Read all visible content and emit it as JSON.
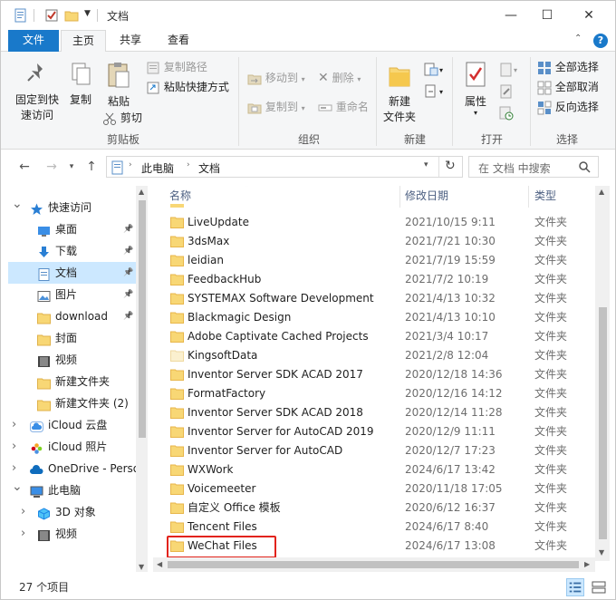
{
  "window": {
    "title": "文档",
    "controls": {
      "minimize": "—",
      "maximize": "☐",
      "close": "✕"
    }
  },
  "tabs": [
    {
      "label": "文件"
    },
    {
      "label": "主页"
    },
    {
      "label": "共享"
    },
    {
      "label": "查看"
    }
  ],
  "ribbon": {
    "clipboard": {
      "pin_label_1": "固定到快",
      "pin_label_2": "速访问",
      "copy_label": "复制",
      "paste_label": "粘贴",
      "copy_path": "复制路径",
      "paste_shortcut": "粘贴快捷方式",
      "cut": "剪切",
      "group": "剪贴板"
    },
    "organize": {
      "move_to": "移动到",
      "copy_to": "复制到",
      "delete": "删除",
      "rename": "重命名",
      "group": "组织"
    },
    "new": {
      "new_folder_1": "新建",
      "new_folder_2": "文件夹",
      "group": "新建"
    },
    "open": {
      "properties": "属性",
      "group": "打开"
    },
    "select": {
      "select_all": "全部选择",
      "select_none": "全部取消",
      "invert": "反向选择",
      "group": "选择"
    }
  },
  "address": {
    "crumbs": [
      "此电脑",
      "文档"
    ],
    "search_placeholder": "在 文档 中搜索"
  },
  "nav": [
    {
      "label": "快速访问",
      "icon": "star-icon",
      "level": 0,
      "arrow": "v"
    },
    {
      "label": "桌面",
      "icon": "desktop-icon",
      "level": 1,
      "pin": true
    },
    {
      "label": "下载",
      "icon": "download-icon",
      "level": 1,
      "pin": true
    },
    {
      "label": "文档",
      "icon": "document-icon",
      "level": 1,
      "pin": true,
      "selected": true
    },
    {
      "label": "图片",
      "icon": "pictures-icon",
      "level": 1,
      "pin": true
    },
    {
      "label": "download",
      "icon": "folder-icon",
      "level": 1,
      "pin": true
    },
    {
      "label": "封面",
      "icon": "folder-icon",
      "level": 1
    },
    {
      "label": "视频",
      "icon": "video-icon",
      "level": 1
    },
    {
      "label": "新建文件夹",
      "icon": "folder-icon",
      "level": 1
    },
    {
      "label": "新建文件夹 (2)",
      "icon": "folder-icon",
      "level": 1
    },
    {
      "label": "iCloud 云盘",
      "icon": "icloud-icon",
      "level": 0,
      "arrow": ">"
    },
    {
      "label": "iCloud 照片",
      "icon": "icloud-photos-icon",
      "level": 0,
      "arrow": ">"
    },
    {
      "label": "OneDrive - Perso",
      "icon": "onedrive-icon",
      "level": 0,
      "arrow": ">"
    },
    {
      "label": "此电脑",
      "icon": "computer-icon",
      "level": 0,
      "arrow": "v"
    },
    {
      "label": "3D 对象",
      "icon": "3d-objects-icon",
      "level": 1,
      "arrow": ">"
    },
    {
      "label": "视频",
      "icon": "video-icon",
      "level": 1,
      "arrow": ">"
    }
  ],
  "columns": {
    "name": "名称",
    "date": "修改日期",
    "type": "类型"
  },
  "files": [
    {
      "name": "LiveUpdate",
      "date": "2021/10/15 9:11",
      "type": "文件夹"
    },
    {
      "name": "3dsMax",
      "date": "2021/7/21 10:30",
      "type": "文件夹"
    },
    {
      "name": "leidian",
      "date": "2021/7/19 15:59",
      "type": "文件夹"
    },
    {
      "name": "FeedbackHub",
      "date": "2021/7/2 10:19",
      "type": "文件夹"
    },
    {
      "name": "SYSTEMAX Software Development",
      "date": "2021/4/13 10:32",
      "type": "文件夹"
    },
    {
      "name": "Blackmagic Design",
      "date": "2021/4/13 10:10",
      "type": "文件夹"
    },
    {
      "name": "Adobe Captivate Cached Projects",
      "date": "2021/3/4 10:17",
      "type": "文件夹"
    },
    {
      "name": "KingsoftData",
      "date": "2021/2/8 12:04",
      "type": "文件夹",
      "faded": true
    },
    {
      "name": "Inventor Server SDK ACAD 2017",
      "date": "2020/12/18 14:36",
      "type": "文件夹"
    },
    {
      "name": "FormatFactory",
      "date": "2020/12/16 14:12",
      "type": "文件夹"
    },
    {
      "name": "Inventor Server SDK ACAD 2018",
      "date": "2020/12/14 11:28",
      "type": "文件夹"
    },
    {
      "name": "Inventor Server for AutoCAD 2019",
      "date": "2020/12/9 11:11",
      "type": "文件夹"
    },
    {
      "name": "Inventor Server for AutoCAD",
      "date": "2020/12/7 17:23",
      "type": "文件夹"
    },
    {
      "name": "WXWork",
      "date": "2024/6/17 13:42",
      "type": "文件夹"
    },
    {
      "name": "Voicemeeter",
      "date": "2020/11/18 17:05",
      "type": "文件夹"
    },
    {
      "name": "自定义 Office 模板",
      "date": "2020/6/12 16:37",
      "type": "文件夹"
    },
    {
      "name": "Tencent Files",
      "date": "2024/6/17 8:40",
      "type": "文件夹"
    },
    {
      "name": "WeChat Files",
      "date": "2024/6/17 13:08",
      "type": "文件夹",
      "highlighted": true
    }
  ],
  "status": {
    "count": "27 个项目"
  },
  "colors": {
    "accent": "#1979ca",
    "folder": "#f8d775",
    "folder_dark": "#e8b64a",
    "highlight": "#e2231a",
    "selection": "#cce8ff"
  }
}
